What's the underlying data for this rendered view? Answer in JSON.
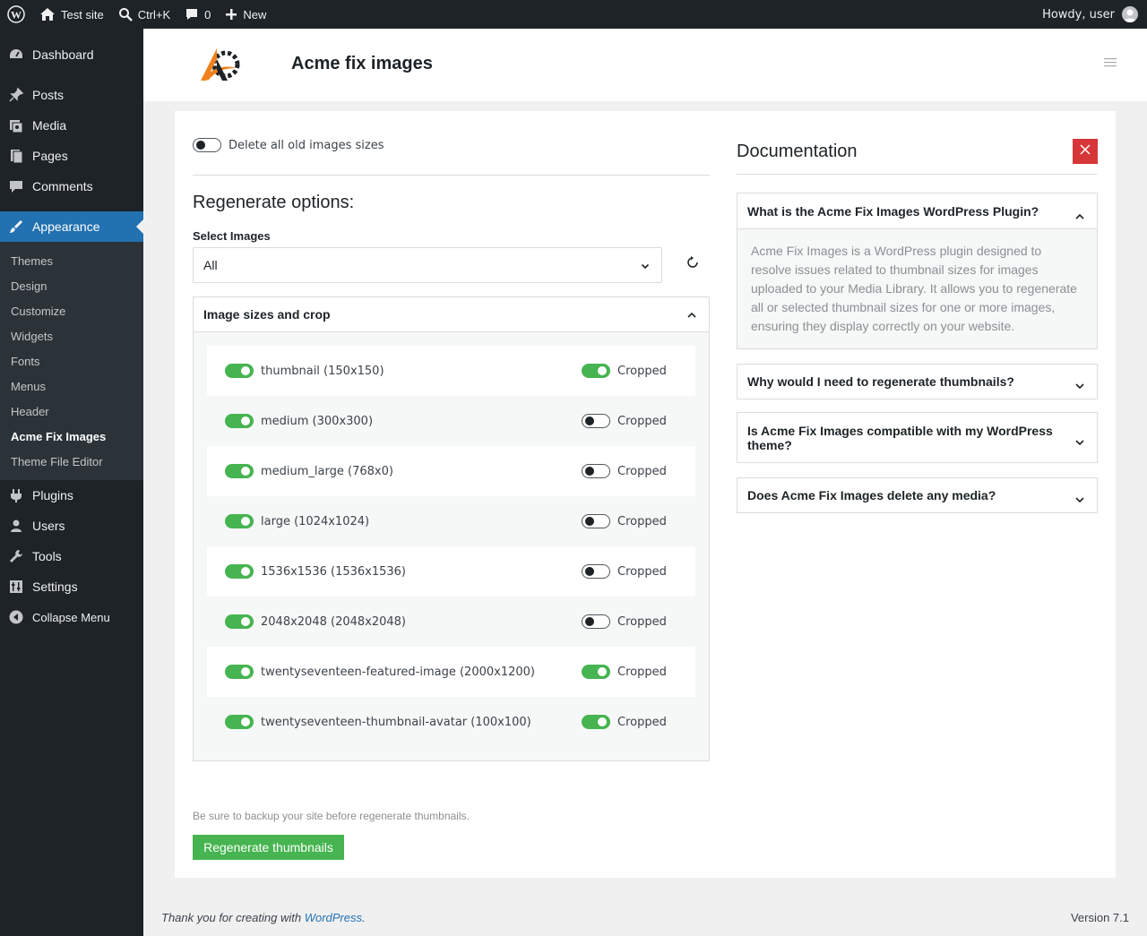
{
  "admin_bar": {
    "site_name": "Test site",
    "search_shortcut": "Ctrl+K",
    "comments_count": "0",
    "new_label": "New",
    "greeting": "Howdy, user"
  },
  "sidebar": {
    "items": [
      {
        "label": "Dashboard",
        "icon": "dashboard-icon"
      },
      {
        "label": "Posts",
        "icon": "pin-icon"
      },
      {
        "label": "Media",
        "icon": "media-icon"
      },
      {
        "label": "Pages",
        "icon": "pages-icon"
      },
      {
        "label": "Comments",
        "icon": "comment-icon"
      },
      {
        "label": "Appearance",
        "icon": "brush-icon"
      },
      {
        "label": "Plugins",
        "icon": "plugin-icon"
      },
      {
        "label": "Users",
        "icon": "user-icon"
      },
      {
        "label": "Tools",
        "icon": "wrench-icon"
      },
      {
        "label": "Settings",
        "icon": "settings-icon"
      },
      {
        "label": "Collapse Menu",
        "icon": "collapse-icon"
      }
    ],
    "submenu": [
      "Themes",
      "Design",
      "Customize",
      "Widgets",
      "Fonts",
      "Menus",
      "Header",
      "Acme Fix Images",
      "Theme File Editor"
    ]
  },
  "header": {
    "title": "Acme fix images"
  },
  "main": {
    "delete_label": "Delete all old images sizes",
    "regen_heading": "Regenerate options:",
    "select_label": "Select Images",
    "select_value": "All",
    "sizes_heading": "Image sizes and crop",
    "sizes": [
      {
        "name": "thumbnail (150x150)",
        "enabled": true,
        "cropped": true
      },
      {
        "name": "medium (300x300)",
        "enabled": true,
        "cropped": false
      },
      {
        "name": "medium_large (768x0)",
        "enabled": true,
        "cropped": false
      },
      {
        "name": "large (1024x1024)",
        "enabled": true,
        "cropped": false
      },
      {
        "name": "1536x1536 (1536x1536)",
        "enabled": true,
        "cropped": false
      },
      {
        "name": "2048x2048 (2048x2048)",
        "enabled": true,
        "cropped": false
      },
      {
        "name": "twentyseventeen-featured-image (2000x1200)",
        "enabled": true,
        "cropped": true
      },
      {
        "name": "twentyseventeen-thumbnail-avatar (100x100)",
        "enabled": true,
        "cropped": true
      }
    ],
    "crop_label": "Cropped",
    "backup_note": "Be sure to backup your site before regenerate thumbnails.",
    "regen_button": "Regenerate thumbnails"
  },
  "documentation": {
    "title": "Documentation",
    "faqs": [
      {
        "q": "What is the Acme Fix Images WordPress Plugin?",
        "a": "Acme Fix Images is a WordPress plugin designed to resolve issues related to thumbnail sizes for images uploaded to your Media Library. It allows you to regenerate all or selected thumbnail sizes for one or more images, ensuring they display correctly on your website."
      },
      {
        "q": "Why would I need to regenerate thumbnails?"
      },
      {
        "q": "Is Acme Fix Images compatible with my WordPress theme?"
      },
      {
        "q": "Does Acme Fix Images delete any media?"
      }
    ]
  },
  "footer": {
    "thanks_prefix": "Thank you for creating with ",
    "thanks_link": "WordPress",
    "thanks_suffix": ".",
    "version": "Version 7.1"
  },
  "colors": {
    "accent": "#2271b1",
    "toggle_on": "#46b450",
    "close_red": "#d63638",
    "sidebar_bg": "#1d2327"
  }
}
